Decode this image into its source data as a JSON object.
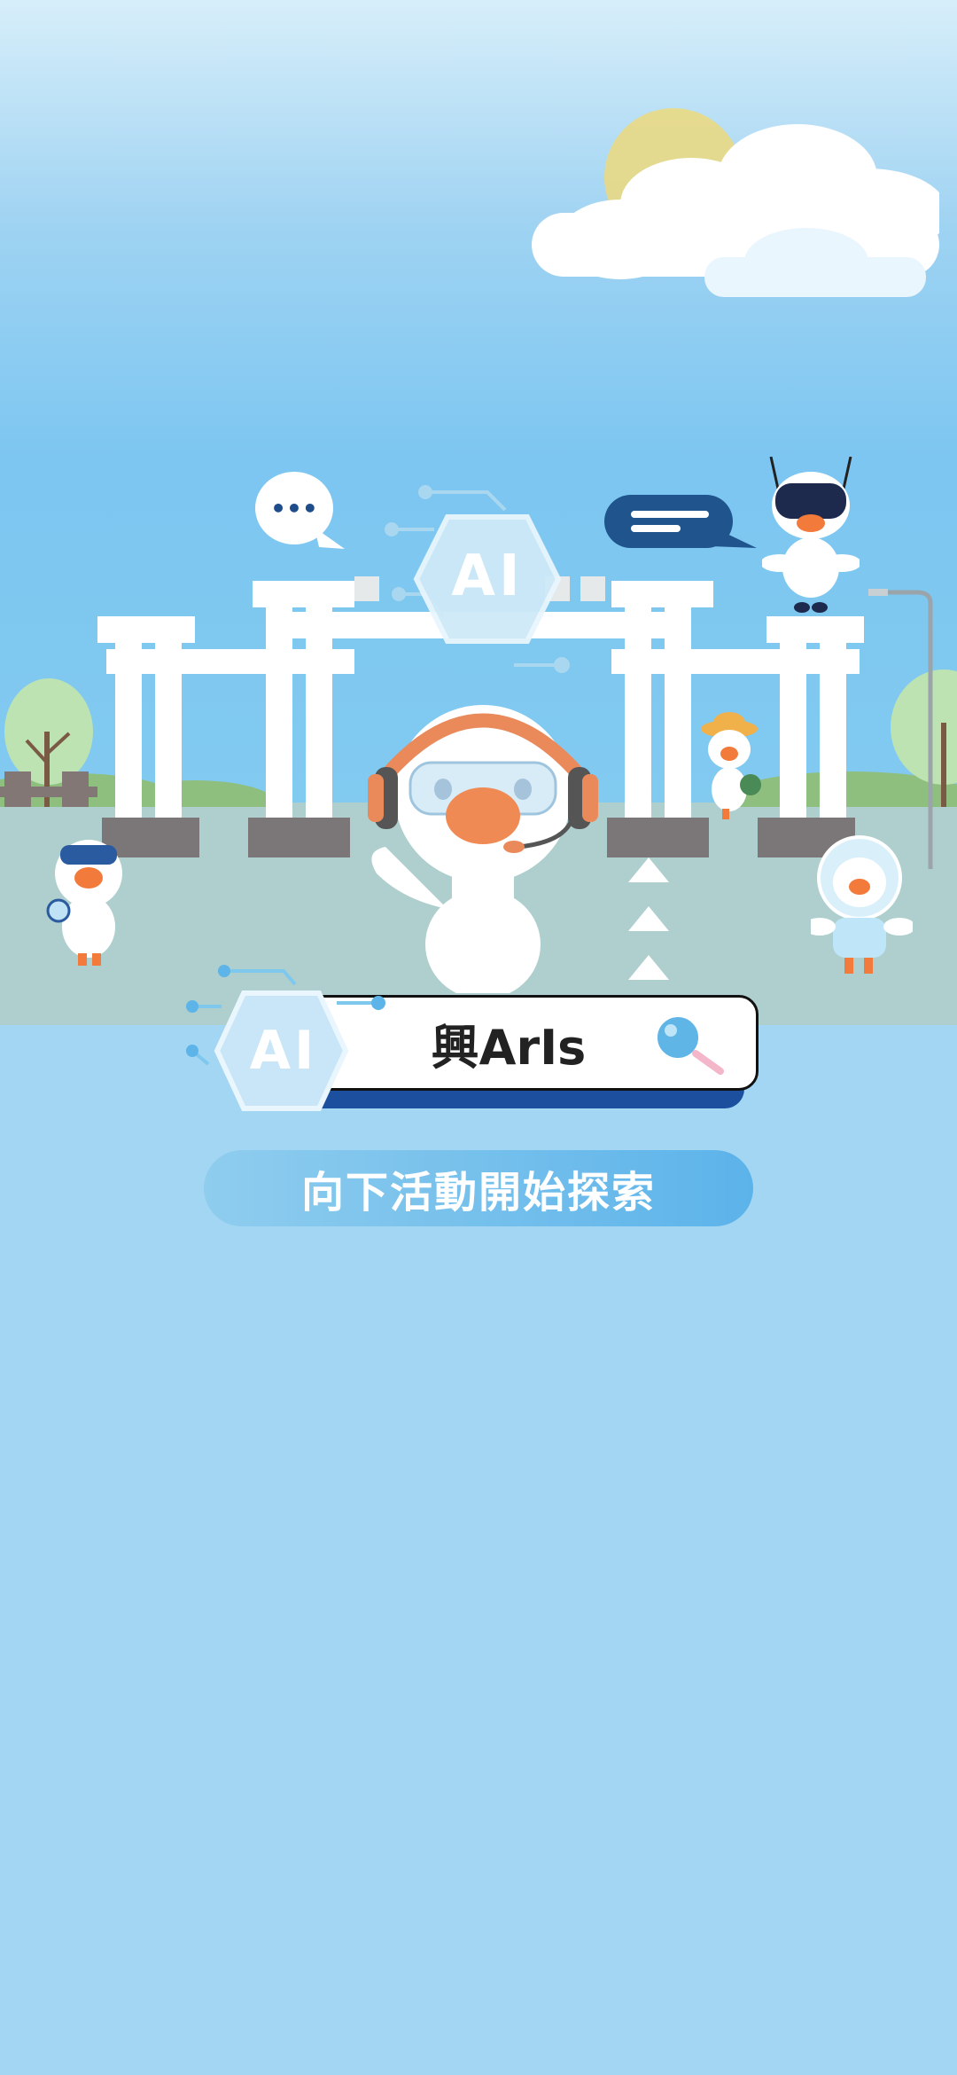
{
  "scene": {
    "badge_text": "AI",
    "speech_bubble_dots": "•••"
  },
  "search": {
    "query": "興ArIs"
  },
  "cta": {
    "label": "向下活動開始探索"
  },
  "colors": {
    "sky_top": "#d7eefa",
    "sky": "#7cc6f1",
    "ground": "#aecfce",
    "lower_bg": "#a3d6f3",
    "accent_dark_blue": "#1c4f9e",
    "button_gradient_start": "#8fcdee",
    "button_gradient_end": "#5cb3ea",
    "duck_beak": "#f27a3a",
    "headphone_orange": "#ea8a5b"
  },
  "icons": [
    "hexagon-ai-badge-icon",
    "speech-bubble-dots-icon",
    "speech-bubble-lines-icon",
    "magnifier-icon",
    "up-arrows-icon"
  ]
}
